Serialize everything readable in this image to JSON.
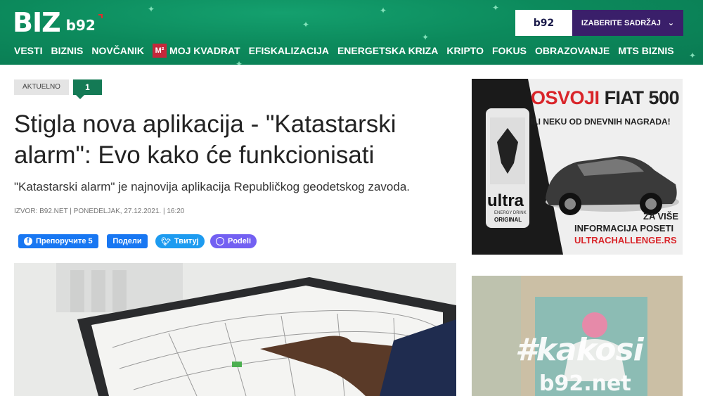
{
  "header": {
    "logo_biz": "BIZ",
    "logo_b92": "b92",
    "b92_box_label": "b92",
    "select_label": "IZABERITE SADRŽAJ",
    "nav": [
      {
        "label": "VESTI"
      },
      {
        "label": "BIZNIS"
      },
      {
        "label": "NOVČANIK"
      },
      {
        "label": "MOJ KVADRAT",
        "badge": "m²"
      },
      {
        "label": "EFISKALIZACIJA"
      },
      {
        "label": "ENERGETSKA KRIZA"
      },
      {
        "label": "KRIPTO"
      },
      {
        "label": "FOKUS"
      },
      {
        "label": "OBRAZOVANJE"
      },
      {
        "label": "MTS BIZNIS"
      }
    ]
  },
  "article": {
    "tag": "AKTUELNO",
    "comment_count": "1",
    "title": "Stigla nova aplikacija - \"Katastarski alarm\": Evo kako će funkcionisati",
    "subtitle": "\"Katastarski alarm\" je najnovija aplikacija Republičkog geodetskog zavoda.",
    "meta": "IZVOR: B92.NET | PONEDELJAK, 27.12.2021. | 16:20"
  },
  "share": {
    "facebook_recommend": "Препоручите 5",
    "facebook_share": "Подели",
    "twitter": "Твитуј",
    "viber": "Podeli"
  },
  "ad1": {
    "headline_red": "OSVOJI",
    "headline_dark": "FIAT 500",
    "sub": "ILI NEKU OD DNEVNIH NAGRADA!",
    "can_brand": "ultra",
    "can_sub": "ENERGY DRINK",
    "can_variant": "ORIGINAL",
    "info1": "ZA VIŠE",
    "info2": "INFORMACIJA POSETI",
    "url": "ULTRACHALLENGE.RS"
  },
  "ad2": {
    "hashtag": "#kakosi",
    "site": "b92.net"
  },
  "colors": {
    "header_green": "#0c8a5c",
    "accent_green": "#147a55",
    "select_purple": "#3a1f6a",
    "ad_red": "#d9252a",
    "facebook": "#1877f2",
    "twitter": "#1d9bf0",
    "viber": "#7360f2"
  }
}
